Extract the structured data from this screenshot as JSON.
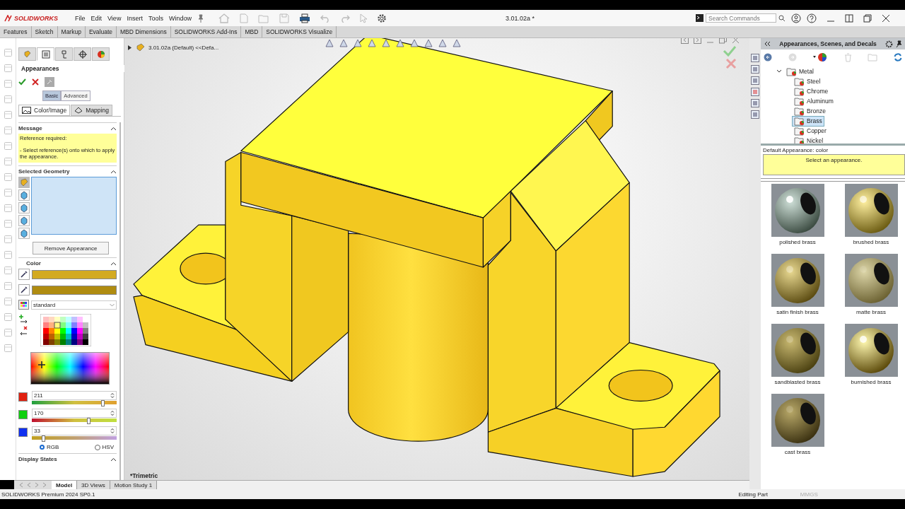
{
  "app": {
    "logo": "SOLIDWORKS",
    "menus": [
      "File",
      "Edit",
      "View",
      "Insert",
      "Tools",
      "Window"
    ],
    "document_title": "3.01.02a *",
    "search": {
      "placeholder": "Search Commands"
    }
  },
  "command_tabs": [
    "Features",
    "Sketch",
    "Markup",
    "Evaluate",
    "MBD Dimensions",
    "SOLIDWORKS Add-Ins",
    "MBD",
    "SOLIDWORKS Visualize"
  ],
  "property_manager": {
    "tabs": [
      {
        "selected": false
      },
      {
        "selected": true
      },
      {
        "selected": false
      },
      {
        "selected": false
      },
      {
        "selected": false
      }
    ],
    "title": "Appearances",
    "modes": [
      {
        "label": "Basic",
        "selected": true
      },
      {
        "label": "Advanced",
        "selected": false
      }
    ],
    "subtabs": [
      {
        "label": "Color/Image",
        "selected": true
      },
      {
        "label": "Mapping",
        "selected": false
      }
    ],
    "message": {
      "title": "Message",
      "heading": "Reference required:",
      "text": "- Select reference(s) onto which to apply the appearance."
    },
    "selected_geometry": {
      "title": "Selected Geometry",
      "button": "Remove Appearance"
    },
    "color": {
      "title": "Color",
      "swatches": [
        {
          "color": "#d3aa21"
        },
        {
          "color": "#b08c10"
        }
      ],
      "palette": "standard",
      "channels": [
        {
          "color": "#e02010",
          "value": "211",
          "level": 0.83
        },
        {
          "color": "#10d010",
          "value": "170",
          "level": 0.67
        },
        {
          "color": "#1030f0",
          "value": "33",
          "level": 0.13
        }
      ],
      "models": [
        {
          "label": "RGB",
          "selected": true
        },
        {
          "label": "HSV",
          "selected": false
        }
      ]
    },
    "display_states": {
      "title": "Display States"
    }
  },
  "viewport": {
    "tree_header": "3.01.02a (Default) <<Defa...",
    "view_name": "*Trimetric"
  },
  "bottom_tabs": [
    {
      "label": "Model",
      "selected": true
    },
    {
      "label": "3D Views",
      "selected": false
    },
    {
      "label": "Motion Study 1",
      "selected": false
    }
  ],
  "task_pane": {
    "title": "Appearances, Scenes, and Decals",
    "tree": [
      {
        "label": "Metal",
        "expanded": true,
        "selected": false,
        "children": [
          {
            "label": "Steel",
            "selected": false
          },
          {
            "label": "Chrome",
            "selected": false
          },
          {
            "label": "Aluminum",
            "selected": false
          },
          {
            "label": "Bronze",
            "selected": false
          },
          {
            "label": "Brass",
            "selected": true
          },
          {
            "label": "Copper",
            "selected": false
          },
          {
            "label": "Nickel",
            "selected": false
          }
        ]
      }
    ],
    "default_appearance": "Default Appearance: color",
    "hint": "Select an appearance.",
    "materials": [
      {
        "name": "polished brass",
        "kind": "polished"
      },
      {
        "name": "brushed brass",
        "kind": "brushed"
      },
      {
        "name": "satin finish brass",
        "kind": "satin"
      },
      {
        "name": "matte brass",
        "kind": "matte"
      },
      {
        "name": "sandblasted brass",
        "kind": "sandblasted"
      },
      {
        "name": "burnished brass",
        "kind": "burnished"
      },
      {
        "name": "cast brass",
        "kind": "cast"
      }
    ]
  },
  "status_bar": {
    "product": "SOLIDWORKS Premium 2024 SP0.1",
    "mode": "Editing Part",
    "units": "MMGS"
  }
}
